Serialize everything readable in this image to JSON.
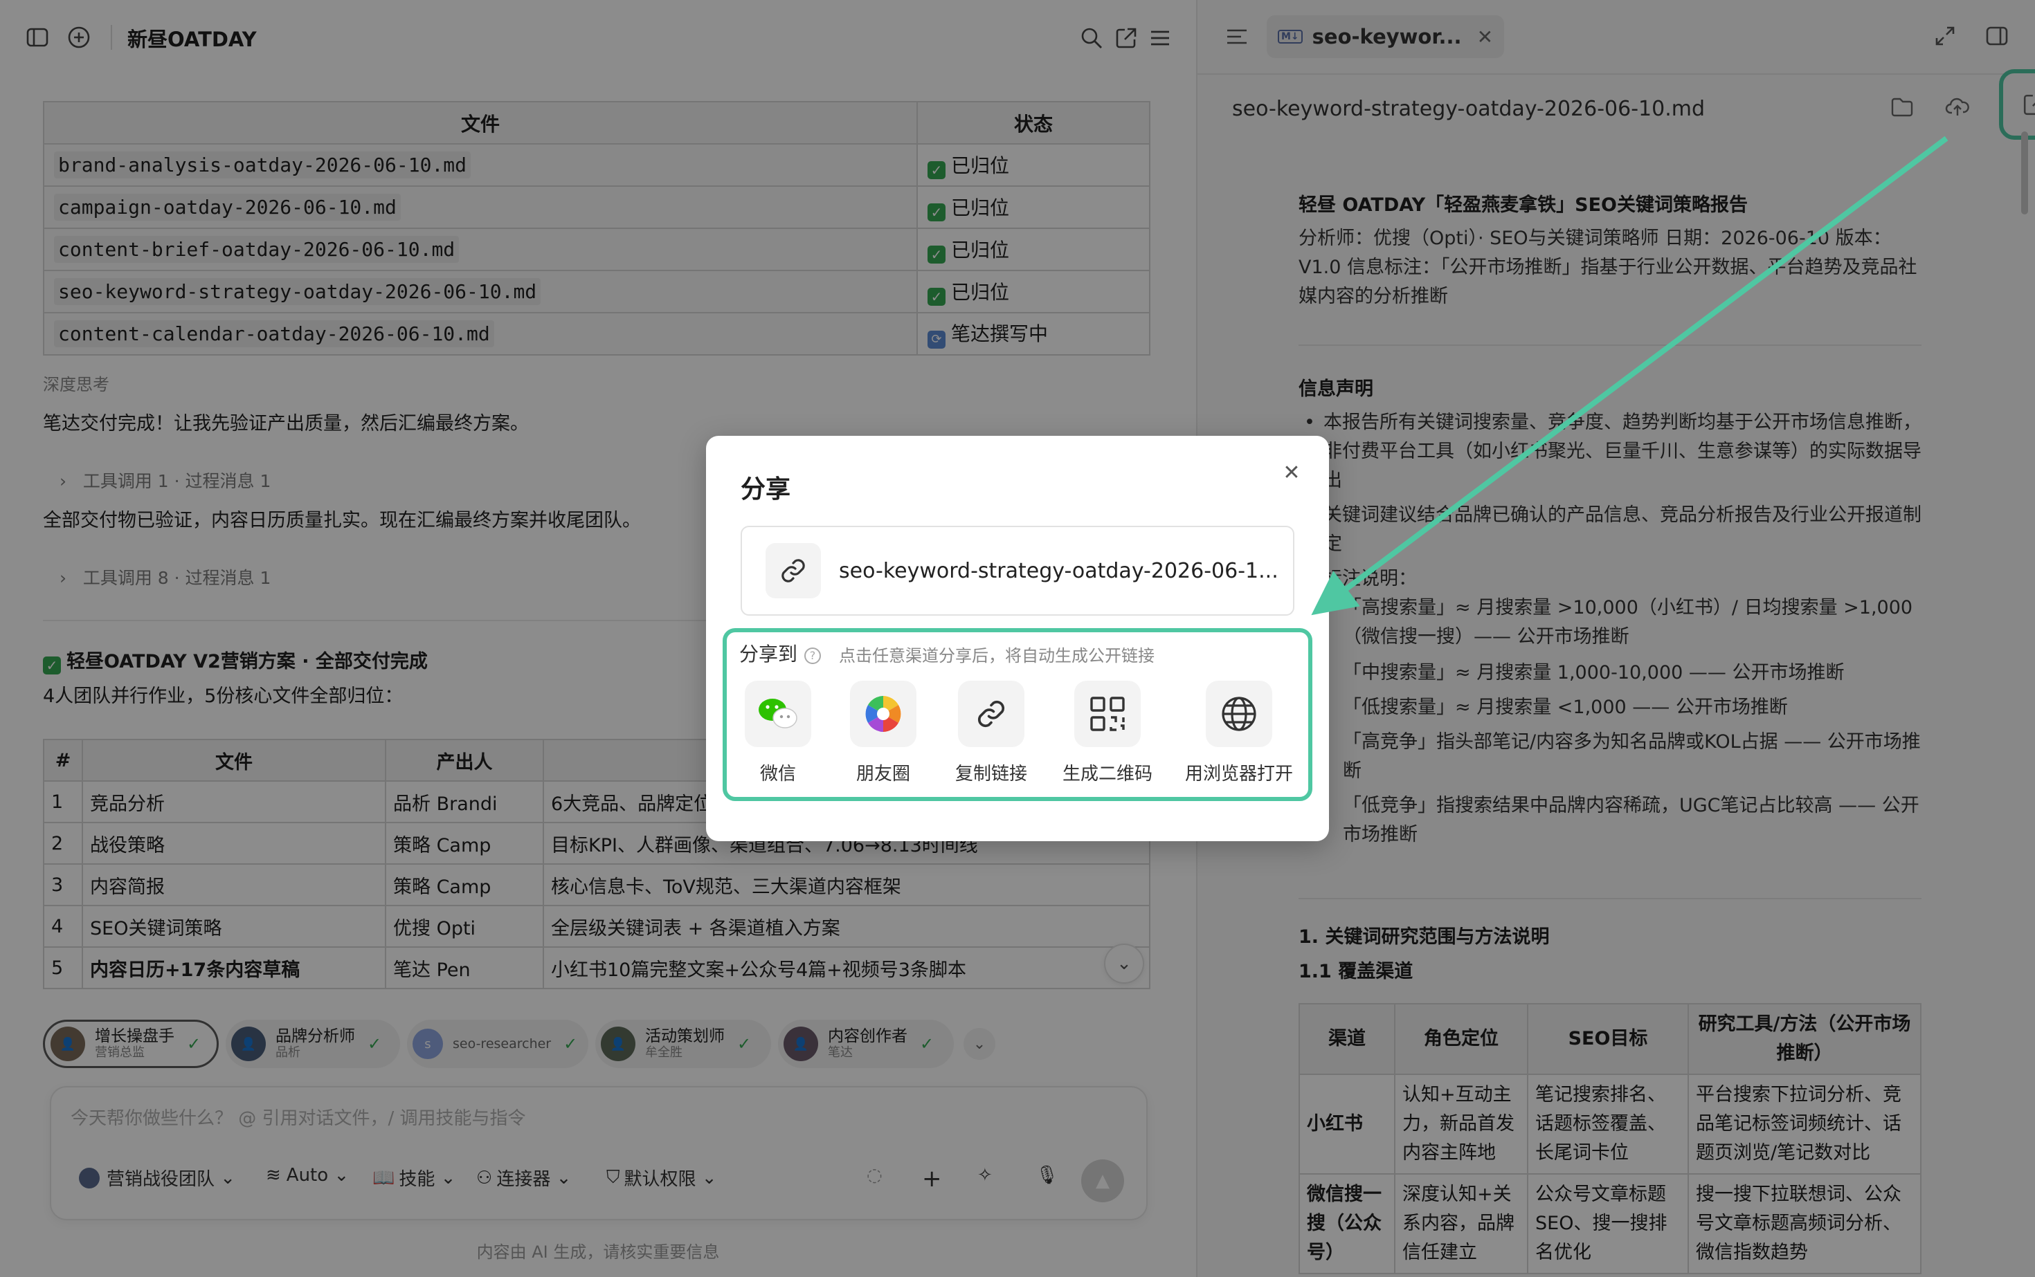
{
  "left": {
    "title": "新昼OATDAY",
    "file_table": {
      "headers": [
        "文件",
        "状态"
      ],
      "rows": [
        {
          "file": "brand-analysis-oatday-2026-06-10.md",
          "status": "已归位",
          "icon": "check"
        },
        {
          "file": "campaign-oatday-2026-06-10.md",
          "status": "已归位",
          "icon": "check"
        },
        {
          "file": "content-brief-oatday-2026-06-10.md",
          "status": "已归位",
          "icon": "check"
        },
        {
          "file": "seo-keyword-strategy-oatday-2026-06-10.md",
          "status": "已归位",
          "icon": "check"
        },
        {
          "file": "content-calendar-oatday-2026-06-10.md",
          "status": "笔达撰写中",
          "icon": "sync"
        }
      ]
    },
    "deep_thinking": "深度思考",
    "msg1": "笔达交付完成！让我先验证产出质量，然后汇编最终方案。",
    "fold1": "工具调用 1 · 过程消息 1",
    "msg2": "全部交付物已验证，内容日历质量扎实。现在汇编最终方案并收尾团队。",
    "fold2": "工具调用 8 · 过程消息 1",
    "summary_title": "轻昼OATDAY V2营销方案 · 全部交付完成",
    "summary_sub": "4人团队并行作业，5份核心文件全部归位：",
    "plan_table": {
      "headers": [
        "#",
        "文件",
        "产出人",
        ""
      ],
      "rows": [
        [
          "1",
          "竞品分析",
          "品析 Brandi",
          "6大竞品、品牌定位"
        ],
        [
          "2",
          "战役策略",
          "策略 Camp",
          "目标KPI、人群画像、渠道组合、7.06→8.13时间线"
        ],
        [
          "3",
          "内容简报",
          "策略 Camp",
          "核心信息卡、ToV规范、三大渠道内容框架"
        ],
        [
          "4",
          "SEO关键词策略",
          "优搜 Opti",
          "全层级关键词表 + 各渠道植入方案"
        ],
        [
          "5",
          "内容日历+17条内容草稿",
          "笔达 Pen",
          "小红书10篇完整文案+公众号4篇+视频号3条脚本"
        ]
      ]
    },
    "agents": [
      {
        "name": "增长操盘手",
        "sub": "营销总监"
      },
      {
        "name": "品牌分析师",
        "sub": "品析"
      },
      {
        "name": "seo-researcher",
        "sub": ""
      },
      {
        "name": "活动策划师",
        "sub": "牟全胜"
      },
      {
        "name": "内容创作者",
        "sub": "笔达"
      }
    ],
    "composer": {
      "placeholder": "今天帮你做些什么？ @ 引用对话文件，/ 调用技能与指令",
      "team": "营销战役团队",
      "model": "Auto",
      "skills": "技能",
      "connectors": "连接器",
      "permissions": "默认权限"
    },
    "footer_note": "内容由 AI 生成，请核实重要信息"
  },
  "dialog": {
    "title": "分享",
    "link_text": "seo-keyword-strategy-oatday-2026-06-1...",
    "share_to": "分享到",
    "hint": "点击任意渠道分享后，将自动生成公开链接",
    "channels": [
      {
        "label": "微信",
        "icon": "wechat-icon"
      },
      {
        "label": "朋友圈",
        "icon": "moments-icon"
      },
      {
        "label": "复制链接",
        "icon": "link-icon"
      },
      {
        "label": "生成二维码",
        "icon": "qrcode-icon"
      },
      {
        "label": "用浏览器打开",
        "icon": "globe-icon"
      }
    ],
    "accent": "#4fc7a2"
  },
  "right": {
    "tab_badge": "M↓",
    "tab_label": "seo-keywor...",
    "file_name": "seo-keyword-strategy-oatday-2026-06-10.md",
    "doc_title": "轻昼 OATDAY「轻盈燕麦拿铁」SEO关键词策略报告",
    "doc_meta": "分析师：优搜（Opti）· SEO与关键词策略师 日期：2026-06-10 版本：V1.0 信息标注：「公开市场推断」指基于行业公开数据、平台趋势及竞品社媒内容的分析推断",
    "info_heading": "信息声明",
    "info_bullets": [
      "本报告所有关键词搜索量、竞争度、趋势判断均基于公开市场信息推断，非付费平台工具（如小红书聚光、巨量千川、生意参谋等）的实际数据导出",
      "关键词建议结合品牌已确认的产品信息、竞品分析报告及行业公开报道制定",
      "标注说明："
    ],
    "sub_items": [
      "「高搜索量」≈ 月搜索量 >10,000（小红书）/ 日均搜索量 >1,000（微信搜一搜）—— 公开市场推断",
      "「中搜索量」≈ 月搜索量 1,000-10,000 —— 公开市场推断",
      "「低搜索量」≈ 月搜索量 <1,000 —— 公开市场推断",
      "「高竞争」指头部笔记/内容多为知名品牌或KOL占据 —— 公开市场推断",
      "「低竞争」指搜索结果中品牌内容稀疏，UGC笔记占比较高 —— 公开市场推断"
    ],
    "section1": "1. 关键词研究范围与方法说明",
    "section11": "1.1 覆盖渠道",
    "channel_table": {
      "headers": [
        "渠道",
        "角色定位",
        "SEO目标",
        "研究工具/方法（公开市场推断）"
      ],
      "rows": [
        [
          "小红书",
          "认知+互动主力，新品首发内容主阵地",
          "笔记搜索排名、话题标签覆盖、长尾词卡位",
          "平台搜索下拉词分析、竞品笔记标签词频统计、话题页浏览/笔记数对比"
        ],
        [
          "微信搜一搜（公众号）",
          "深度认知+关系内容，品牌信任建立",
          "公众号文章标题SEO、搜一搜排名优化",
          "搜一搜下拉联想词、公众号文章标题高频词分析、微信指数趋势"
        ]
      ]
    }
  }
}
